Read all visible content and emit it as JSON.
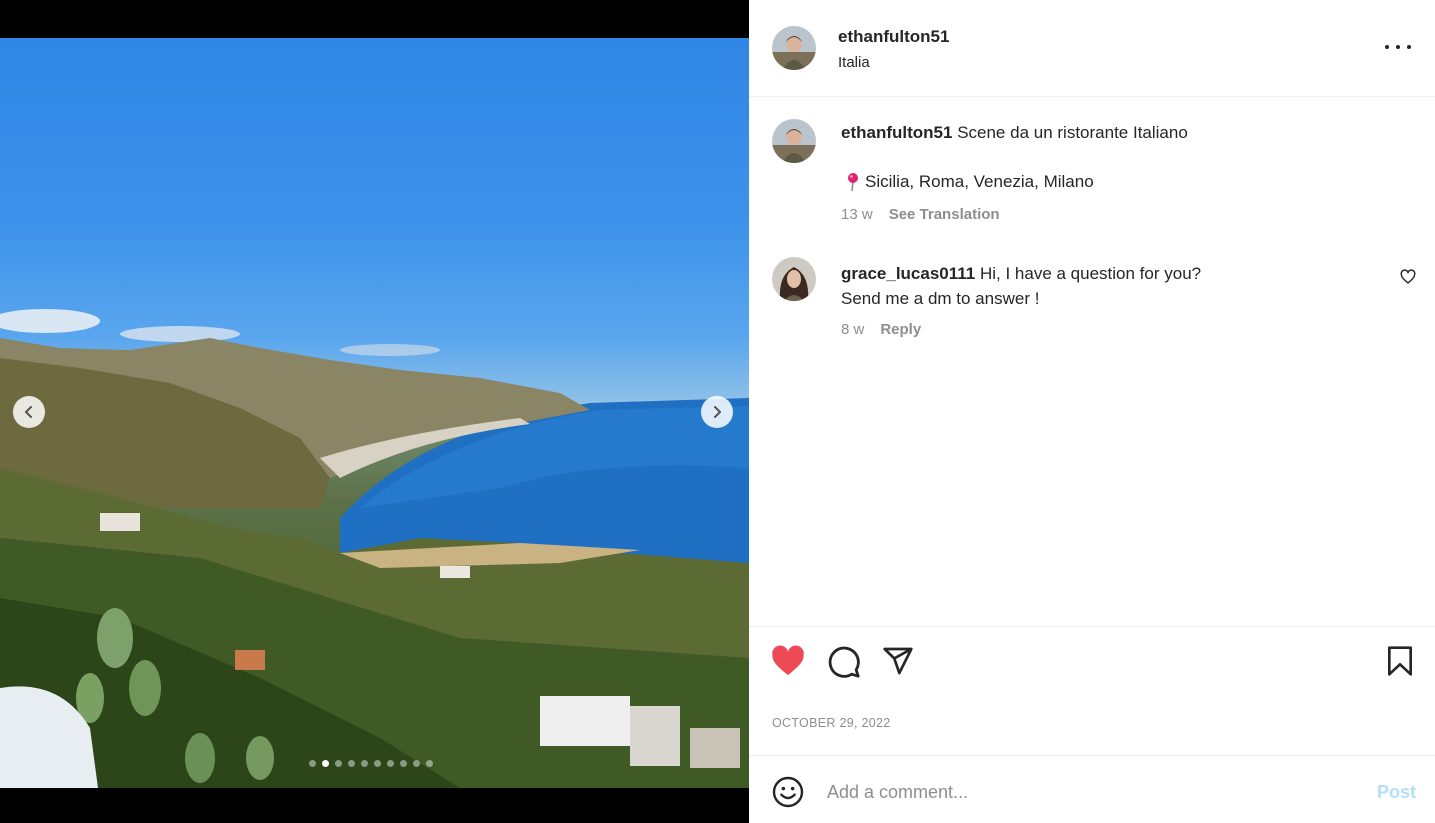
{
  "post": {
    "username": "ethanfulton51",
    "location": "Italia",
    "carousel": {
      "total_slides": 10,
      "active_slide": 2
    }
  },
  "caption": {
    "username": "ethanfulton51",
    "text": "Scene da un ristorante Italiano",
    "line2_icon": "round-pushpin-emoji",
    "line2": "Sicilia, Roma, Venezia, Milano",
    "age": "13 w",
    "translation": "See Translation"
  },
  "comment": {
    "username": "grace_lucas0111",
    "text_line1": "Hi, I have a question for you?",
    "text_line2": "Send me a dm to answer !",
    "age": "8 w",
    "reply": "Reply"
  },
  "actions": {
    "like_icon": "heart-filled-icon",
    "comment_icon": "comment-icon",
    "share_icon": "share-icon",
    "save_icon": "bookmark-icon",
    "like_color": "#ed4956"
  },
  "date": "OCTOBER 29, 2022",
  "add_comment": {
    "placeholder": "Add a comment...",
    "post_label": "Post",
    "post_color": "#b2dffc",
    "emoji_icon": "emoji-icon"
  }
}
